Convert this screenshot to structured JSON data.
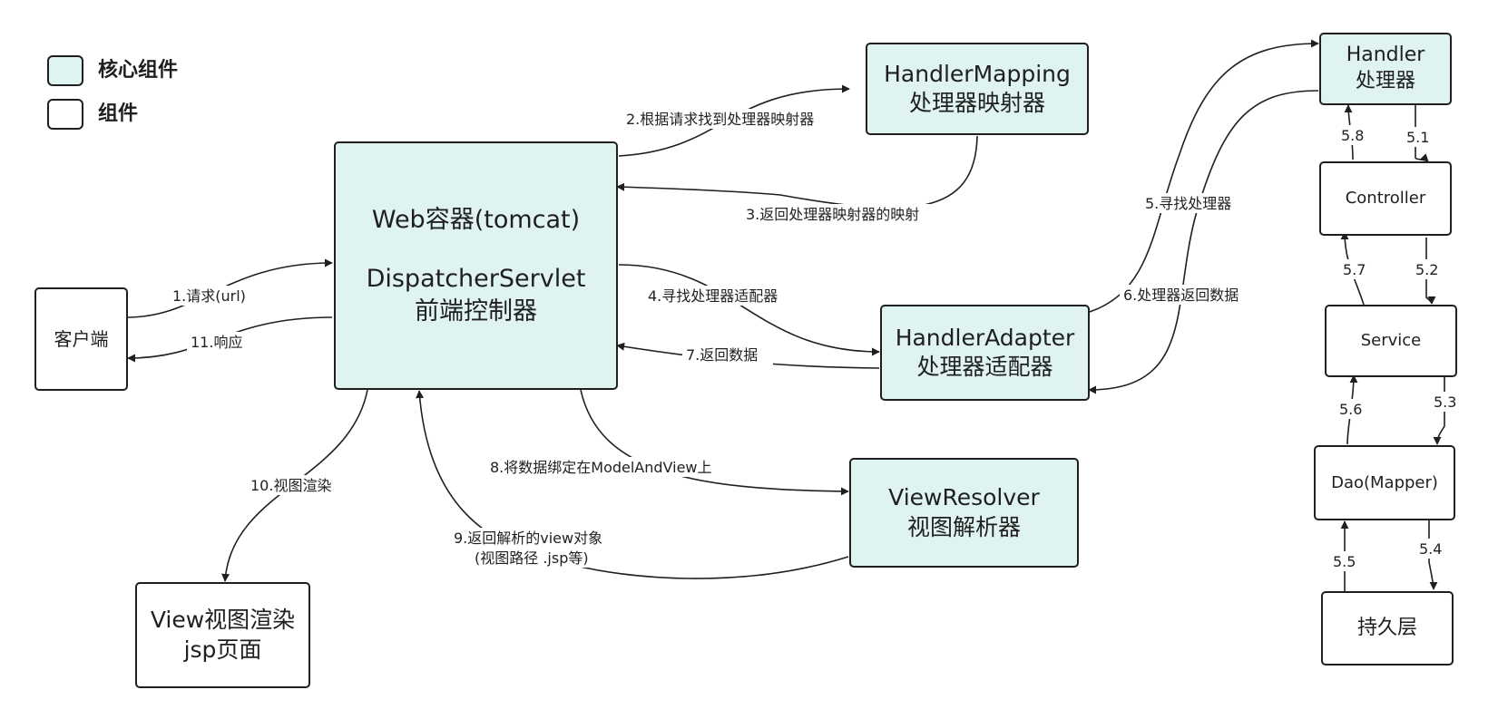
{
  "legend": {
    "core_label": "核心组件",
    "plain_label": "组件",
    "core_color": "#dff3f1"
  },
  "nodes": {
    "client": "客户端",
    "dispatcher": {
      "line1": "Web容器(tomcat)",
      "line2": "DispatcherServlet",
      "line3": "前端控制器"
    },
    "handler_mapping": {
      "line1": "HandlerMapping",
      "line2": "处理器映射器"
    },
    "handler_adapter": {
      "line1": "HandlerAdapter",
      "line2": "处理器适配器"
    },
    "view_resolver": {
      "line1": "ViewResolver",
      "line2": "视图解析器"
    },
    "view": {
      "line1": "View视图渲染",
      "line2": "jsp页面"
    },
    "handler": {
      "line1": "Handler",
      "line2": "处理器"
    },
    "controller": "Controller",
    "service": "Service",
    "dao": "Dao(Mapper)",
    "persistence": "持久层"
  },
  "edges": {
    "e1": "1.请求(url)",
    "e2": "2.根据请求找到处理器映射器",
    "e3": "3.返回处理器映射器的映射",
    "e4": "4.寻找处理器适配器",
    "e5": "5.寻找处理器",
    "e6": "6.处理器返回数据",
    "e7": "7.返回数据",
    "e8": "8.将数据绑定在ModelAndView上",
    "e9a": "9.返回解析的view对象",
    "e9b": "(视图路径 .jsp等)",
    "e10": "10.视图渲染",
    "e11": "11.响应",
    "s51": "5.1",
    "s52": "5.2",
    "s53": "5.3",
    "s54": "5.4",
    "s55": "5.5",
    "s56": "5.6",
    "s57": "5.7",
    "s58": "5.8"
  }
}
